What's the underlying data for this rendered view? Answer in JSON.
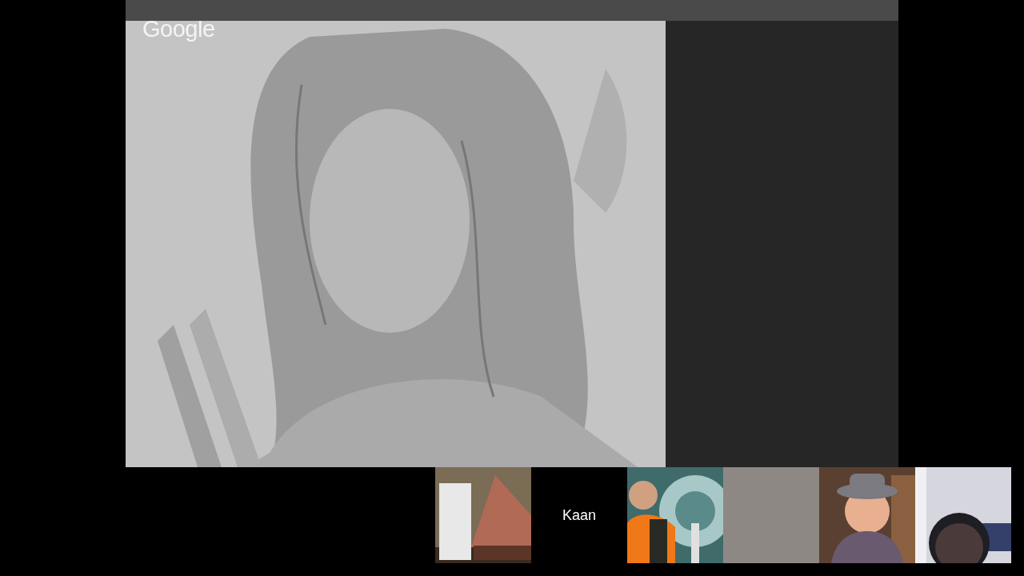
{
  "logo": "Google",
  "main_video": {
    "kind": "picture"
  },
  "participants": [
    {
      "kind": "picture"
    },
    {
      "kind": "name",
      "name": "Kaan"
    },
    {
      "kind": "picture"
    },
    {
      "kind": "blank"
    },
    {
      "kind": "picture"
    },
    {
      "kind": "picture"
    }
  ]
}
